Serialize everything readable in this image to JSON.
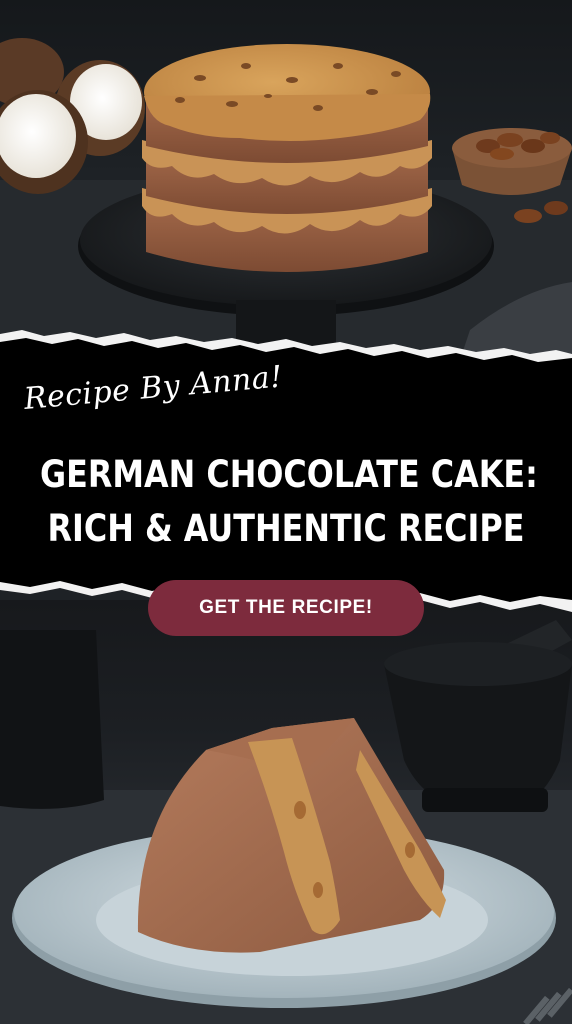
{
  "byline": "Recipe By Anna!",
  "headline": {
    "line1": "GERMAN CHOCOLATE CAKE:",
    "line2": "RICH & AUTHENTIC RECIPE"
  },
  "cta_label": "GET THE RECIPE!",
  "colors": {
    "banner": "#000000",
    "button": "#7d2b3d",
    "text": "#ffffff"
  }
}
